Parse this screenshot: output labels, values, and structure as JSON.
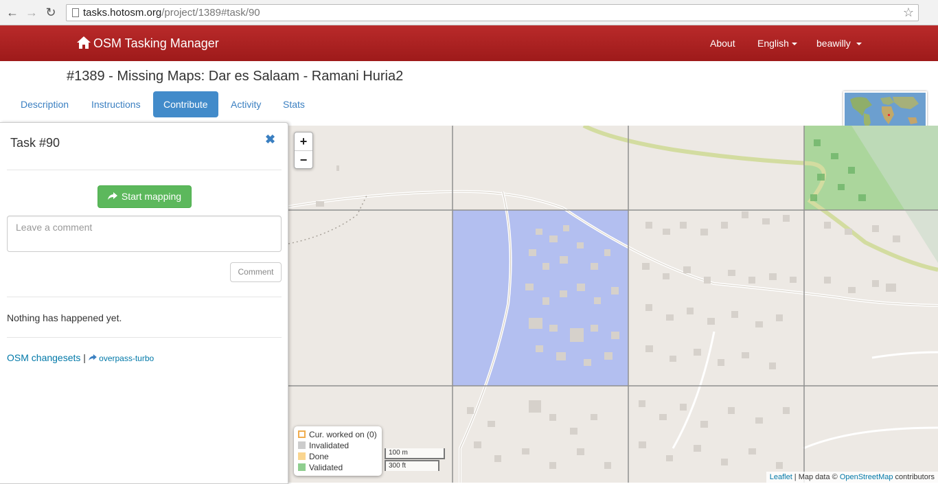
{
  "browser": {
    "url_host": "tasks.hotosm.org",
    "url_path": "/project/1389#task/90"
  },
  "navbar": {
    "brand": "OSM Tasking Manager",
    "about": "About",
    "language": "English",
    "user": "beawilly"
  },
  "project": {
    "title": "#1389 - Missing Maps: Dar es Salaam - Ramani Huria2"
  },
  "tabs": [
    {
      "label": "Description"
    },
    {
      "label": "Instructions"
    },
    {
      "label": "Contribute"
    },
    {
      "label": "Activity"
    },
    {
      "label": "Stats"
    }
  ],
  "active_tab": "Contribute",
  "task": {
    "title": "Task #90",
    "start_label": "Start mapping",
    "comment_placeholder": "Leave a comment",
    "comment_button": "Comment",
    "history_text": "Nothing has happened yet.",
    "changesets_link": "OSM changesets",
    "separator": "|",
    "overpass_link": "overpass-turbo"
  },
  "map": {
    "zoom_in": "+",
    "zoom_out": "−",
    "legend": [
      {
        "label": "Cur. worked on (0)",
        "color": "#ffffff",
        "border": "#f0ad4e"
      },
      {
        "label": "Invalidated",
        "color": "#cccccc",
        "border": "#cccccc"
      },
      {
        "label": "Done",
        "color": "#fad58f",
        "border": "#fad58f"
      },
      {
        "label": "Validated",
        "color": "#8fce8f",
        "border": "#8fce8f"
      }
    ],
    "scale_metric": "100 m",
    "scale_imperial": "300 ft",
    "attribution_leaflet": "Leaflet",
    "attribution_data": " | Map data © ",
    "attribution_osm": "OpenStreetMap",
    "attribution_contrib": " contributors"
  },
  "colors": {
    "navbar": "#ab2323",
    "selected_task": "#b3bff0",
    "validated_task": "#8fce8f",
    "link": "#3a7fc1",
    "start_button": "#5cb85c"
  }
}
